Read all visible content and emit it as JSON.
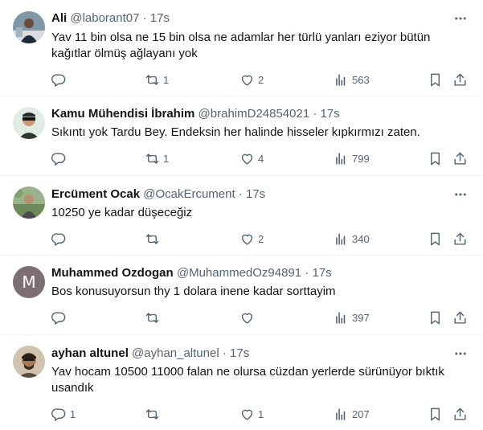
{
  "tweets": [
    {
      "name": "Ali",
      "handle": "@laborant07",
      "sep": "·",
      "time": "17s",
      "text": "Yav 11 bin olsa ne 15 bin olsa ne adamlar her türlü yanları eziyor bütün kağıtlar ölmüş ağlayanı yok",
      "replies": "",
      "retweets": "1",
      "likes": "2",
      "views": "563"
    },
    {
      "name": "Kamu Mühendisi İbrahim",
      "handle": "@brahimD24854021",
      "sep": "·",
      "time": "17s",
      "text": "Sıkıntı yok Tardu Bey. Endeksin her halinde hisseler kıpkırmızı zaten.",
      "replies": "",
      "retweets": "1",
      "likes": "4",
      "views": "799"
    },
    {
      "name": "Ercüment Ocak",
      "handle": "@OcakErcument",
      "sep": "·",
      "time": "17s",
      "text": "10250 ye kadar düşeceğiz",
      "replies": "",
      "retweets": "",
      "likes": "2",
      "views": "340"
    },
    {
      "name": "Muhammed Ozdogan",
      "handle": "@MuhammedOz94891",
      "sep": "·",
      "time": "17s",
      "avatar_letter": "M",
      "text": "Bos konusuyorsun thy 1 dolara inene kadar sorttayim",
      "replies": "",
      "retweets": "",
      "likes": "",
      "views": "397"
    },
    {
      "name": "ayhan altunel",
      "handle": "@ayhan_altunel",
      "sep": "·",
      "time": "17s",
      "text": "Yav hocam 10500 11000 falan ne olursa cüzdan yerlerde sürünüyor bıktık usandık",
      "replies": "1",
      "retweets": "",
      "likes": "1",
      "views": "207"
    }
  ],
  "colors": {
    "text": "#0f1419",
    "muted": "#536471",
    "divider": "#eff3f4",
    "avatar_m": "#7d6e75"
  },
  "icons": [
    "more-icon",
    "reply-icon",
    "retweet-icon",
    "like-icon",
    "views-icon",
    "bookmark-icon",
    "share-icon"
  ]
}
